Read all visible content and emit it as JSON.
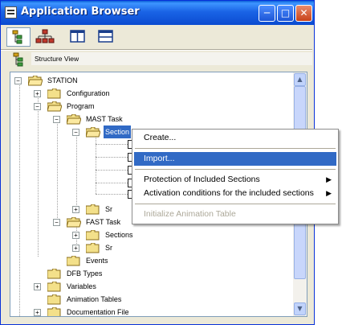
{
  "window": {
    "title": "Application Browser"
  },
  "toolbar": {
    "buttons": [
      "structure-view-icon",
      "hierarchy-view-icon",
      "split-vertical-icon",
      "split-horizontal-icon"
    ]
  },
  "header": {
    "label": "Structure View"
  },
  "tree": {
    "nodes": [
      {
        "label": "STATION"
      },
      {
        "label": "Configuration"
      },
      {
        "label": "Program"
      },
      {
        "label": "MAST Task"
      },
      {
        "label": "Section"
      },
      {
        "label": "Sr"
      },
      {
        "label": "FAST Task"
      },
      {
        "label": "Sections"
      },
      {
        "label": "Sr"
      },
      {
        "label": "Events"
      },
      {
        "label": "DFB Types"
      },
      {
        "label": "Variables"
      },
      {
        "label": "Animation Tables"
      },
      {
        "label": "Documentation File"
      }
    ]
  },
  "context_menu": {
    "items": [
      {
        "label": "Create...",
        "state": "normal"
      },
      {
        "label": "Import...",
        "state": "highlighted"
      },
      {
        "label": "Protection of Included Sections",
        "state": "submenu"
      },
      {
        "label": "Activation conditions for the included sections",
        "state": "submenu"
      },
      {
        "label": "Initialize Animation Table",
        "state": "disabled"
      }
    ]
  },
  "colors": {
    "selection": "#316ac5",
    "title_bar": "#0b4bd0",
    "window_bg": "#ece9d8"
  }
}
